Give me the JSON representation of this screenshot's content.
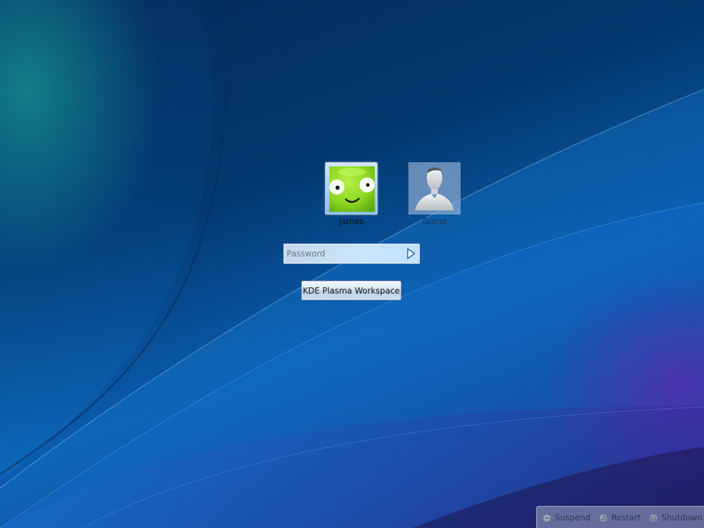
{
  "users": [
    {
      "name": "James",
      "avatar": "green-smiley-face",
      "selected": true
    },
    {
      "name": "Guest",
      "avatar": "generic-person-silhouette",
      "selected": false
    }
  ],
  "password": {
    "placeholder": "Password",
    "value": "",
    "submit_icon": "arrow-right-icon"
  },
  "session": {
    "label": "KDE Plasma Workspace"
  },
  "power": {
    "items": [
      {
        "label": "Suspend",
        "icon": "suspend-icon"
      },
      {
        "label": "Restart",
        "icon": "restart-icon"
      },
      {
        "label": "Shutdown",
        "icon": "shutdown-icon"
      }
    ]
  },
  "colors": {
    "background_primary": "#0a5db0",
    "background_dark": "#03386e",
    "accent_teal": "#148c82",
    "accent_purple": "#820096",
    "avatar_green": "#8ed621"
  }
}
